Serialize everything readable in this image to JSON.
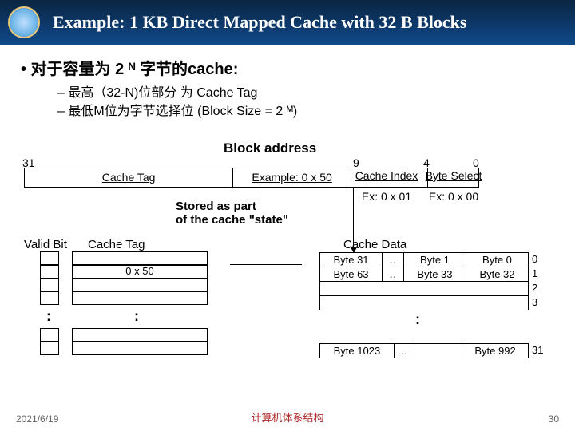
{
  "header": {
    "title": "Example: 1 KB Direct Mapped Cache with 32 B Blocks"
  },
  "bullets": {
    "main": "对于容量为 2 ᴺ 字节的cache:",
    "sub1": "最高（32-N)位部分 为 Cache Tag",
    "sub2": "最低M位为字节选择位 (Block Size = 2 ᴹ)"
  },
  "addr": {
    "label": "Block address",
    "bit31": "31",
    "bit9": "9",
    "bit4": "4",
    "bit0": "0",
    "tag": "Cache Tag",
    "example": "Example: 0 x 50",
    "index": "Cache Index",
    "index_ex": "Ex: 0 x 01",
    "byte_select": "Byte Select",
    "byte_select_ex": "Ex: 0 x 00",
    "stored": "Stored as part\nof the cache \"state\""
  },
  "columns": {
    "valid": "Valid Bit",
    "tag": "Cache Tag",
    "data": "Cache Data",
    "tag_value": "0 x 50"
  },
  "data_rows": {
    "r0": [
      "Byte 31",
      "‥",
      "Byte 1",
      "Byte 0"
    ],
    "r1": [
      "Byte 63",
      "‥",
      "Byte 33",
      "Byte 32"
    ],
    "last": [
      "Byte 1023",
      "‥",
      "",
      "Byte 992"
    ],
    "nums": [
      "0",
      "1",
      "2",
      "3",
      "31"
    ]
  },
  "vdots": ":",
  "footer": {
    "date": "2021/6/19",
    "mid": "计算机体系结构",
    "page": "30"
  }
}
